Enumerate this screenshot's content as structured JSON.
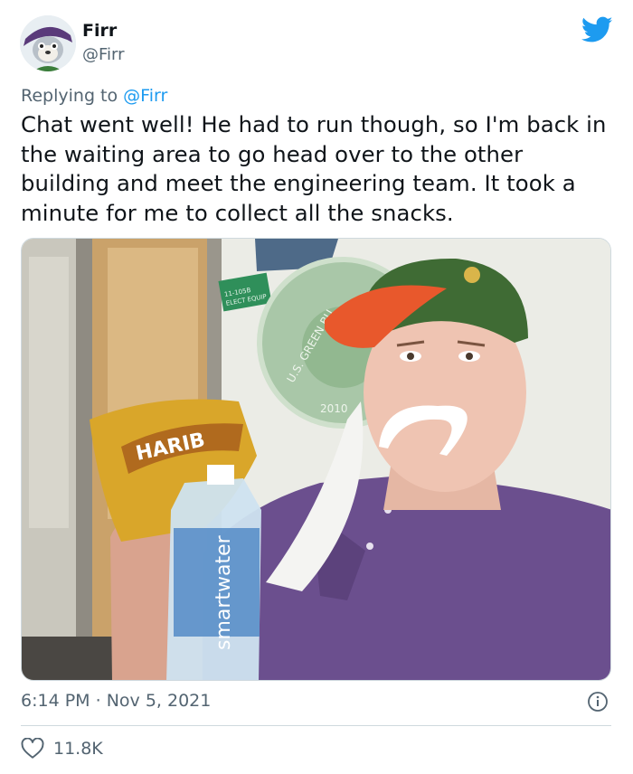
{
  "author": {
    "name": "Firr",
    "handle": "@Firr"
  },
  "reply": {
    "prefix": "Replying to",
    "target": "@Firr"
  },
  "tweet": {
    "text": "Chat went well! He had to run though, so I'm back in the waiting area to go head over to the other building and meet the engineering team. It took a minute for me to collect all the snacks."
  },
  "photo": {
    "sign_text": [
      "11-105B",
      "ELECT EQUIP"
    ],
    "plaque_text": "U.S. GREEN BU",
    "plaque_year": "2010",
    "snack_brand": "HARIB",
    "bottle_brand": "smartwater"
  },
  "timestamp": {
    "time": "6:14 PM",
    "separator": "·",
    "date": "Nov 5, 2021"
  },
  "engagement": {
    "likes": "11.8K"
  },
  "colors": {
    "accent": "#1d9bf0",
    "secondary": "#536471",
    "shirt": "#6b4f8e",
    "cap": "#3f6b34"
  },
  "icons": [
    "avatar",
    "twitter-bird-icon",
    "info-icon",
    "heart-icon"
  ]
}
